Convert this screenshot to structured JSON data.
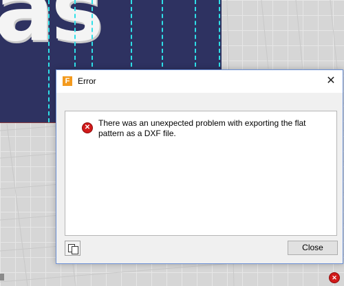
{
  "dialog": {
    "title": "Error",
    "app_icon_glyph": "F",
    "close_glyph": "✕",
    "message": "There was an unexpected problem with exporting the flat pattern as a DXF file.",
    "error_icon_glyph": "✕",
    "copy_button_icon": "copy-to-clipboard-icon",
    "close_button_label": "Close"
  },
  "viewport": {
    "part_text": "as",
    "part_color": "#2e3261",
    "edge_color": "#2fe0e8"
  },
  "status": {
    "error_indicator_glyph": "✕"
  }
}
